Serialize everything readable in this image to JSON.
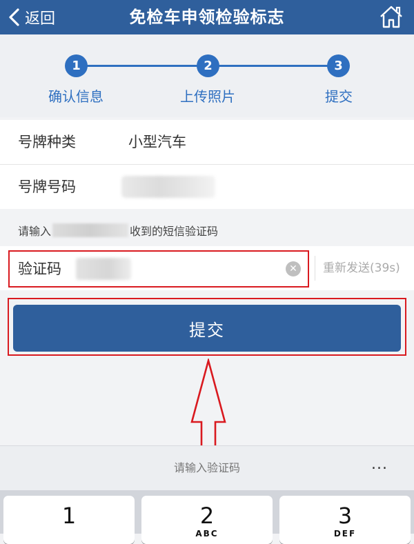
{
  "navbar": {
    "back_label": "返回",
    "title": "免检车申领检验标志",
    "home_icon": "home-icon"
  },
  "steps": [
    {
      "number": "1",
      "label": "确认信息"
    },
    {
      "number": "2",
      "label": "上传照片"
    },
    {
      "number": "3",
      "label": "提交"
    }
  ],
  "info": {
    "plate_type_label": "号牌种类",
    "plate_type_value": "小型汽车",
    "plate_number_label": "号牌号码"
  },
  "sms_hint": {
    "prefix": "请输入",
    "suffix": "收到的短信验证码"
  },
  "code_input": {
    "label": "验证码",
    "resend_label": "重新发送(39s)"
  },
  "submit_label": "提交",
  "keyboard": {
    "hint": "请输入验证码",
    "more": "...",
    "keys": [
      {
        "num": "1",
        "letters": ""
      },
      {
        "num": "2",
        "letters": "ABC"
      },
      {
        "num": "3",
        "letters": "DEF"
      }
    ]
  },
  "colors": {
    "primary": "#2f5f9c",
    "step_active": "#2e6fc0",
    "highlight": "#d9191f"
  }
}
